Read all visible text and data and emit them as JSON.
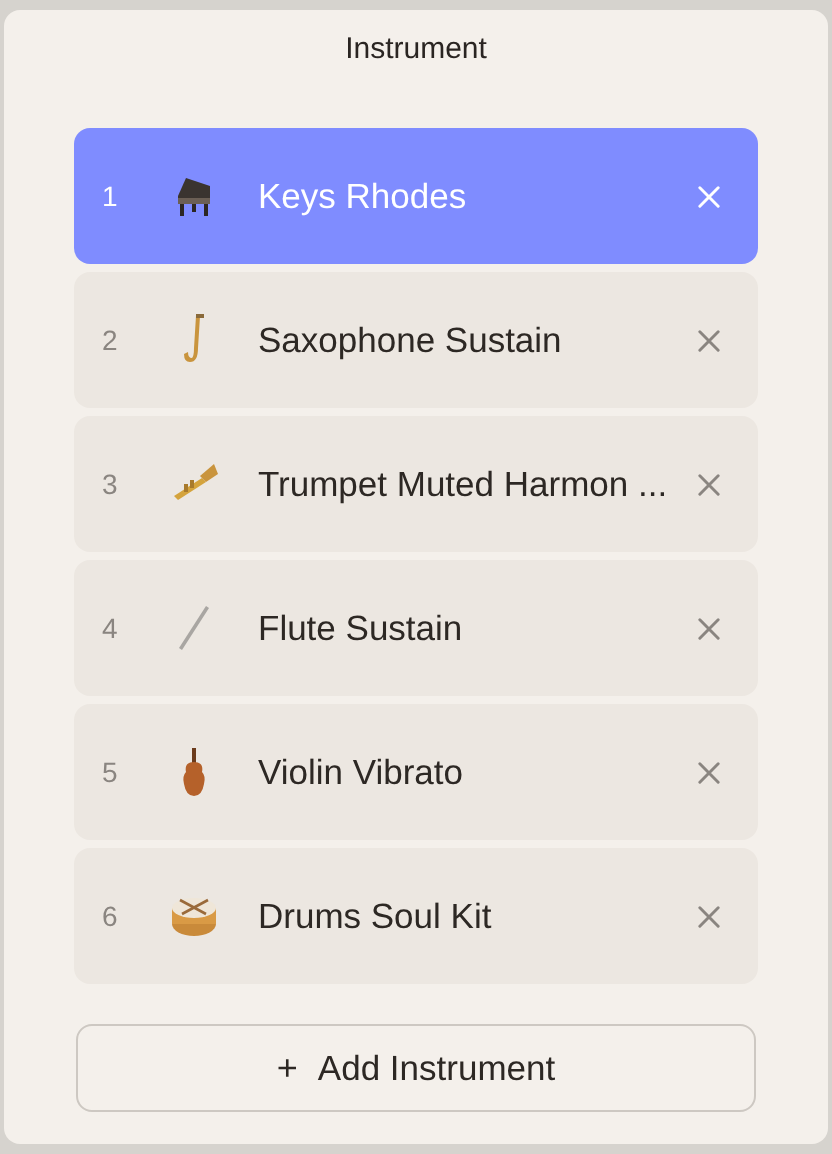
{
  "title": "Instrument",
  "instruments": [
    {
      "number": "1",
      "name": "Keys Rhodes",
      "selected": true
    },
    {
      "number": "2",
      "name": "Saxophone Sustain",
      "selected": false
    },
    {
      "number": "3",
      "name": "Trumpet Muted Harmon ...",
      "selected": false
    },
    {
      "number": "4",
      "name": "Flute Sustain",
      "selected": false
    },
    {
      "number": "5",
      "name": "Violin Vibrato",
      "selected": false
    },
    {
      "number": "6",
      "name": "Drums Soul Kit",
      "selected": false
    }
  ],
  "add_button": {
    "icon": "+",
    "label": "Add Instrument"
  }
}
